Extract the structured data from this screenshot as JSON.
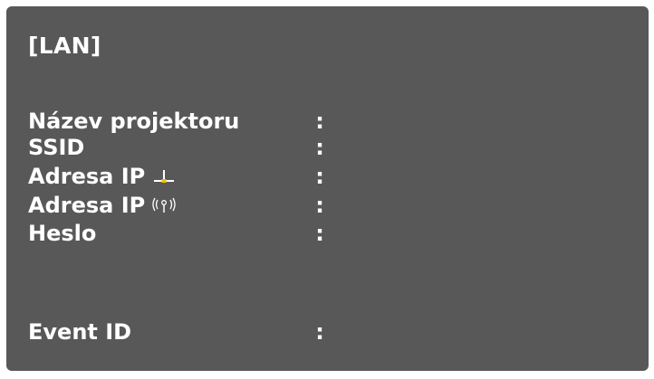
{
  "panel": {
    "title": "[LAN]"
  },
  "rows": [
    {
      "label": "Název projektoru",
      "icon": "",
      "separator": ":",
      "value": ""
    },
    {
      "label": "SSID",
      "icon": "",
      "separator": ":",
      "value": ""
    },
    {
      "label": "Adresa IP",
      "icon": "wired-lan-icon",
      "separator": ":",
      "value": ""
    },
    {
      "label": "Adresa IP",
      "icon": "wireless-lan-icon",
      "separator": ":",
      "value": ""
    },
    {
      "label": "Heslo",
      "icon": "",
      "separator": ":",
      "value": ""
    },
    {
      "label": "Event ID",
      "icon": "",
      "separator": ":",
      "value": ""
    }
  ],
  "colors": {
    "panel_background": "#585858",
    "text": "#ffffff",
    "icon_accent": "#f0c000"
  }
}
